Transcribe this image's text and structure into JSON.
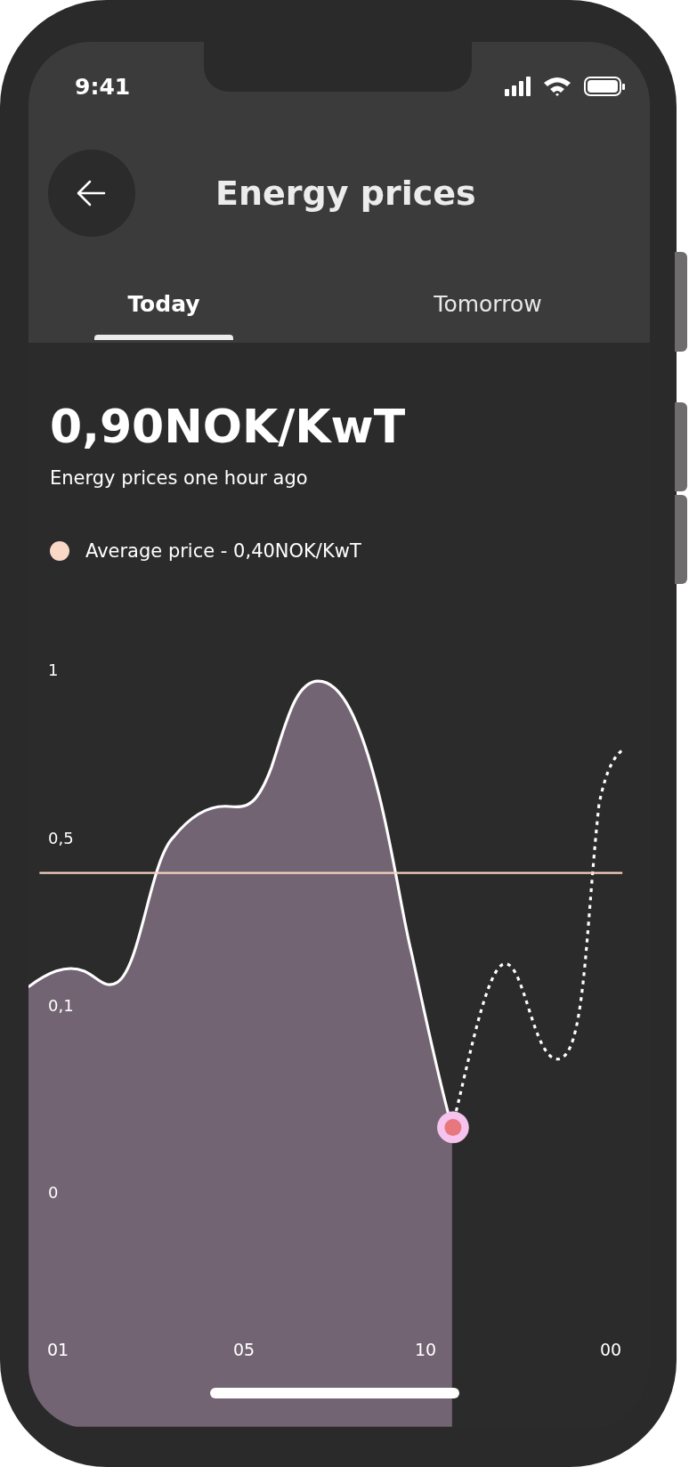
{
  "status_bar": {
    "time": "9:41"
  },
  "header": {
    "title": "Energy prices"
  },
  "tabs": [
    {
      "label": "Today",
      "selected": true
    },
    {
      "label": "Tomorrow",
      "selected": false
    }
  ],
  "price": {
    "value": "0,90NOK/KwT",
    "caption": "Energy prices one hour ago"
  },
  "legend": {
    "label": "Average price - 0,40NOK/KwT"
  },
  "chart": {
    "y_labels": [
      "1",
      "0,5",
      "0,1",
      "0"
    ],
    "x_labels": [
      "01",
      "05",
      "10",
      "00"
    ]
  }
}
